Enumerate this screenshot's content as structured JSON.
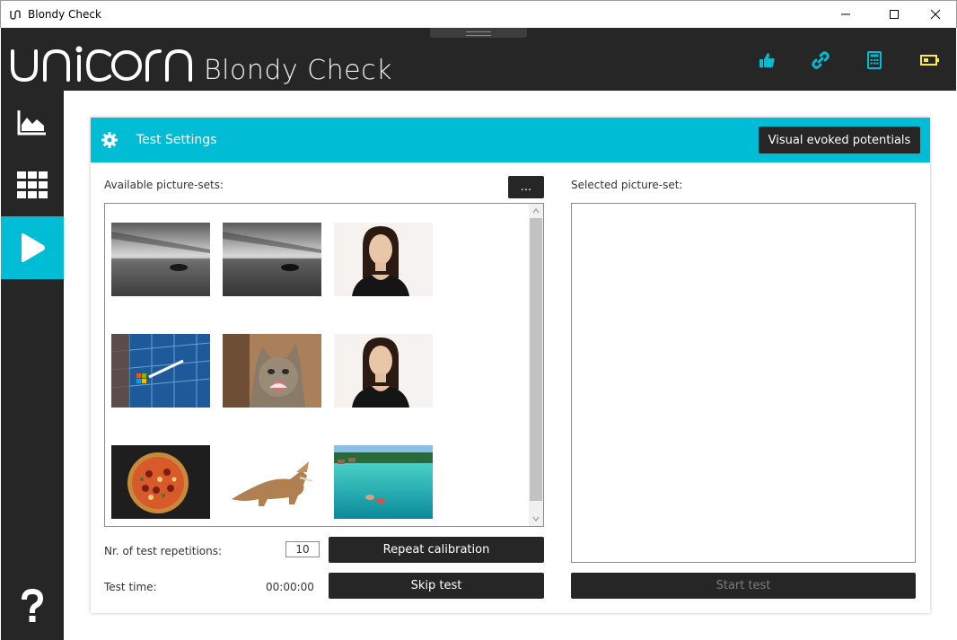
{
  "window": {
    "title": "Blondy Check",
    "icon": "unicorn-app-icon"
  },
  "header": {
    "logo_text": "unicorn",
    "product_name": "Blondy Check",
    "icons": [
      "thumbs-up-icon",
      "link-icon",
      "calculator-icon",
      "battery-icon"
    ],
    "accent_color": "#00bcd4",
    "battery_color": "#ffeb3b"
  },
  "sidebar": {
    "items": [
      {
        "icon": "area-chart-icon"
      },
      {
        "icon": "grid-icon"
      },
      {
        "icon": "play-icon",
        "active": true
      }
    ],
    "help_icon": "question-mark-icon"
  },
  "settings": {
    "title": "Test Settings",
    "vep_button": "Visual evoked potentials",
    "available_label": "Available picture-sets:",
    "more_button": "...",
    "selected_label": "Selected picture-set:",
    "thumbnails": [
      {
        "icon": "beach-boat-bw-image"
      },
      {
        "icon": "beach-boat-bw-image"
      },
      {
        "icon": "woman-portrait-image"
      },
      {
        "icon": "microsoft-building-image"
      },
      {
        "icon": "kitten-image"
      },
      {
        "icon": "woman-portrait-image"
      },
      {
        "icon": "pizza-image"
      },
      {
        "icon": "dinosaur-toy-image"
      },
      {
        "icon": "tropical-lagoon-image"
      }
    ],
    "repetitions_label": "Nr. of test repetitions:",
    "repetitions_value": "10",
    "repeat_calibration": "Repeat calibration",
    "test_time_label": "Test time:",
    "test_time_value": "00:00:00",
    "skip_test": "Skip test",
    "start_test": "Start test"
  }
}
